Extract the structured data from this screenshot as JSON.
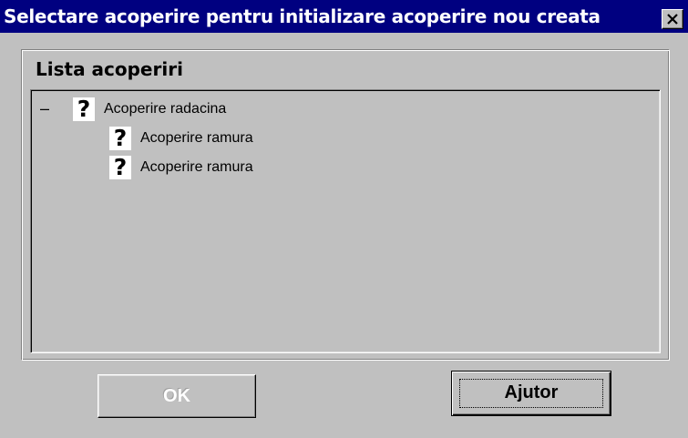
{
  "window": {
    "title": "Selectare acoperire pentru initializare acoperire nou creata",
    "close_icon": "close-icon"
  },
  "group": {
    "label": "Lista acoperiri"
  },
  "tree": {
    "collapse_symbol": "–",
    "root": {
      "icon": "?",
      "label": "Acoperire radacina"
    },
    "children": [
      {
        "icon": "?",
        "label": "Acoperire ramura"
      },
      {
        "icon": "?",
        "label": "Acoperire ramura"
      }
    ]
  },
  "buttons": {
    "ok_label": "OK",
    "ok_disabled": true,
    "help_label": "Ajutor"
  },
  "colors": {
    "titlebar": "#000080",
    "face": "#c0c0c0",
    "title_text": "#ffffff"
  }
}
